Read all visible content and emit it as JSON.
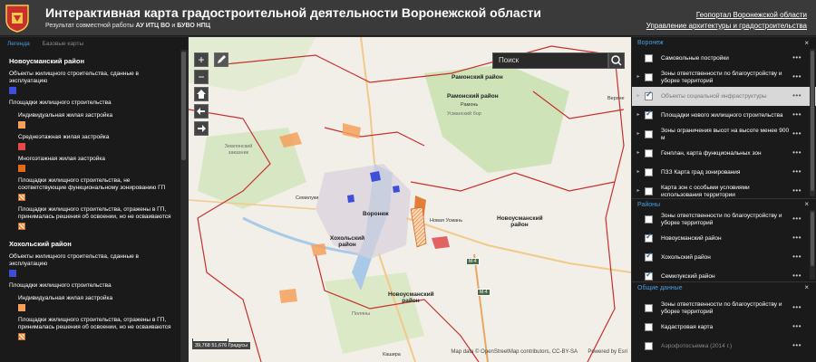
{
  "header": {
    "title": "Интерактивная карта градостроительной деятельности Воронежской области",
    "subtitle_prefix": "Результат совместной работы",
    "subtitle_org1": "АУ ИТЦ ВО",
    "subtitle_and": "и",
    "subtitle_org2": "БУВО НПЦ",
    "link1": "Геопортал Воронежской области",
    "link2": "Управление архитектуры и градостроительства"
  },
  "left_panel": {
    "tab_legend": "Легенда",
    "tab_basemaps": "Базовые карты",
    "region1": "Новоусманский район",
    "r1_item1": "Объекты жилищного строительства, сданные в эксплуатацию",
    "r1_group": "Площадки жилищного строительства",
    "r1_sub1": "Индивидуальная жилая застройка",
    "r1_sub2": "Среднеэтажная жилая застройка",
    "r1_sub3": "Многоэтажная жилая застройка",
    "r1_sub4": "Площадки жилищного строительства, не соответствующие функциональному зонированию ГП",
    "r1_sub5": "Площадки жилищного строительства, отражены в ГП, принималась решения об освоении, но не осваиваются",
    "region2": "Хохольский район",
    "r2_item1": "Объекты жилищного строительства, сданные в эксплуатацию",
    "r2_group": "Площадки жилищного строительства",
    "r2_sub1": "Индивидуальная жилая застройка",
    "r2_sub2": "Площадки жилищного строительства, отражены в ГП, принималась решения об освоении, но не осваиваются"
  },
  "colors": {
    "built": "#3d4fd9",
    "individual": "#f5a05a",
    "midrise": "#e04a4a",
    "highrise": "#e06a1a",
    "boundary": "#c9302c",
    "water": "#a9c9e8",
    "forest": "#cfe3b8",
    "link_blue": "#4a9de0"
  },
  "map": {
    "search_placeholder": "Поиск",
    "zoom_in": "+",
    "zoom_out": "−",
    "labels": {
      "ramon": "Рамонский район",
      "ramon2": "Рамонский район",
      "ramon_town": "Рамонь",
      "verkh": "Верхне",
      "zemlyansk": "Землянский заказник",
      "usman_bor": "Усманский бор",
      "voronezh": "Воронеж",
      "novaya_usman": "Новая Усмань",
      "novousman_r": "Новоусманский район",
      "novousman_r2": "Новоусманский район",
      "khokhol": "Хохольский район",
      "polyany": "Поляны",
      "semiluki": "Семилуки",
      "kashira": "Кашира",
      "m4a": "М-4",
      "m4b": "М-4"
    },
    "scale_coords": "39,768 51,676 Градусы",
    "attribution": "Map data © OpenStreetMap contributors, CC-BY-SA",
    "powered": "Powered by Esri"
  },
  "right_panel": {
    "sec1_title": "Воронеж",
    "sec1_items": [
      {
        "label": "Самовольные постройки",
        "checked": false,
        "expand": false
      },
      {
        "label": "Зоны ответственности по благоустройству и уборке территорий",
        "checked": false,
        "expand": true
      },
      {
        "label": "Объекты социальной инфраструктуры",
        "checked": true,
        "expand": true
      },
      {
        "label": "Площадки нового жилищного строительства",
        "checked": true,
        "expand": true
      },
      {
        "label": "Зоны ограничения высот на высоте менее 900 м",
        "checked": false,
        "expand": true
      },
      {
        "label": "Генплан, карта функциональных зон",
        "checked": false,
        "expand": true
      },
      {
        "label": "ПЗЗ Карта град зонирования",
        "checked": false,
        "expand": true
      },
      {
        "label": "Карта зон с особыми условиями использования территории",
        "checked": false,
        "expand": true
      }
    ],
    "sec2_title": "Районы",
    "sec2_items": [
      {
        "label": "Зоны ответственности по благоустройству и уборке территорий",
        "checked": false
      },
      {
        "label": "Новоусманский район",
        "checked": true
      },
      {
        "label": "Хохольский район",
        "checked": true
      },
      {
        "label": "Семилукский район",
        "checked": true
      }
    ],
    "sec3_title": "Общие данные",
    "sec3_items": [
      {
        "label": "Зоны ответственности по благоустройству и уборке территорий",
        "checked": false
      },
      {
        "label": "Кадастровая карта",
        "checked": false
      },
      {
        "label": "Аэрофотосъемка (2014 г.)",
        "checked": false
      }
    ],
    "close": "×",
    "more": "•••"
  }
}
